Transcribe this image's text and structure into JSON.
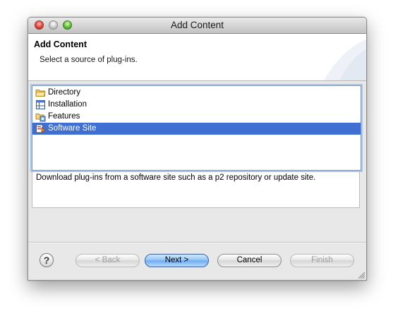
{
  "window": {
    "title": "Add Content"
  },
  "header": {
    "title": "Add Content",
    "description": "Select a source of plug-ins."
  },
  "source_list": {
    "items": [
      {
        "label": "Directory",
        "icon": "folder-icon",
        "selected": false
      },
      {
        "label": "Installation",
        "icon": "installation-icon",
        "selected": false
      },
      {
        "label": "Features",
        "icon": "features-icon",
        "selected": false
      },
      {
        "label": "Software Site",
        "icon": "software-site-icon",
        "selected": true
      }
    ]
  },
  "description_box": {
    "text": "Download plug-ins from a software site such as a p2 repository or update site."
  },
  "buttons": {
    "help": "?",
    "back": "< Back",
    "next": "Next >",
    "cancel": "Cancel",
    "finish": "Finish"
  },
  "colors": {
    "selection": "#3f6fd2",
    "list_focus_border": "#6e9ad6",
    "default_button": "#8ac0f5",
    "window_background": "#e8e8e8"
  }
}
